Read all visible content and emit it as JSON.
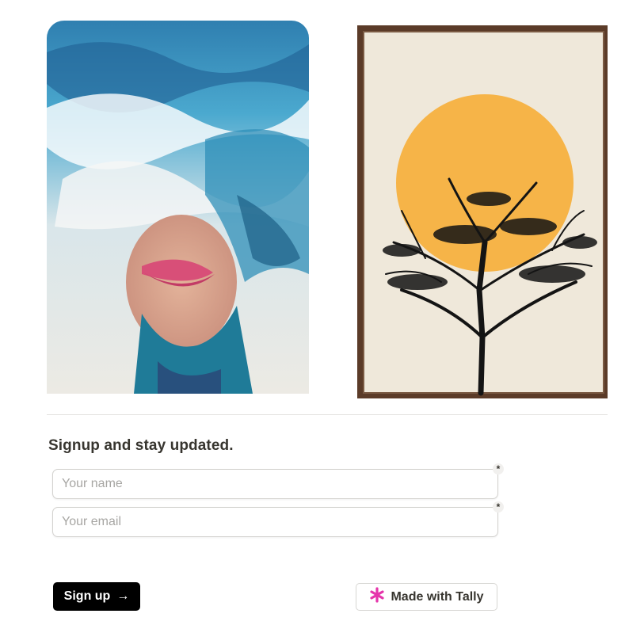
{
  "images": {
    "left_alt": "Painting of a woman's face dissolving into ocean waves",
    "right_alt": "Framed print of an orange sun behind a bare tree"
  },
  "form": {
    "heading": "Signup and stay updated.",
    "name": {
      "placeholder": "Your name",
      "value": "",
      "required_mark": "*"
    },
    "email": {
      "placeholder": "Your email",
      "value": "",
      "required_mark": "*"
    },
    "submit_label": "Sign up",
    "submit_icon": "arrow-right-icon"
  },
  "branding": {
    "label": "Made with Tally",
    "icon": "tally-asterisk-icon",
    "icon_color": "#e535ab"
  },
  "colors": {
    "submit_bg": "#000000",
    "sun": "#f6b448",
    "frame": "#5b3b28"
  }
}
